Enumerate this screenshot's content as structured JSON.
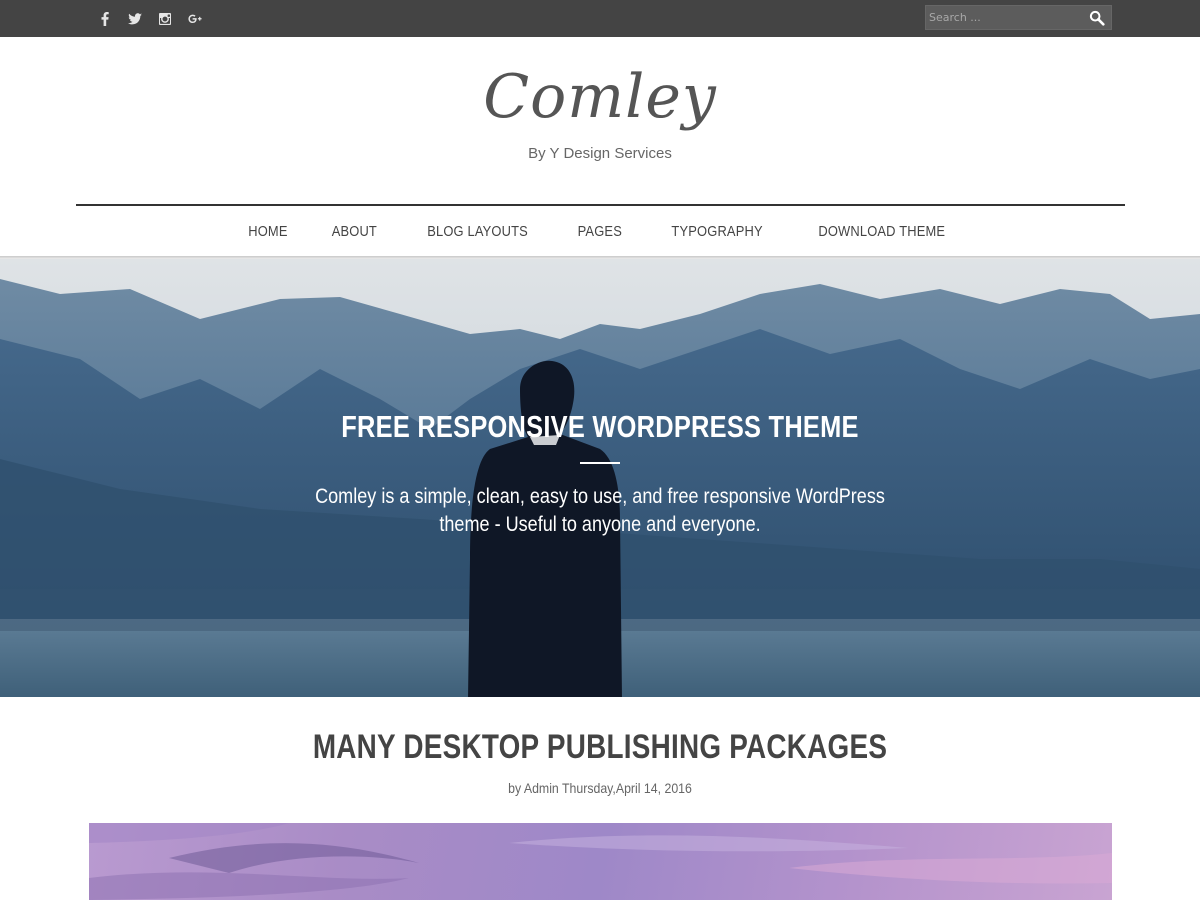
{
  "topbar": {
    "social": [
      {
        "name": "facebook-icon",
        "glyph": "f"
      },
      {
        "name": "twitter-icon",
        "glyph": ""
      },
      {
        "name": "instagram-icon",
        "glyph": ""
      },
      {
        "name": "google-plus-icon",
        "glyph": "g+"
      }
    ],
    "search": {
      "placeholder": "Search ...",
      "value": "",
      "icon": "search-icon"
    }
  },
  "header": {
    "logo": "Comley",
    "tagline": "By Y Design Services"
  },
  "nav": {
    "items": [
      "HOME",
      "ABOUT",
      "BLOG LAYOUTS",
      "PAGES",
      "TYPOGRAPHY",
      "DOWNLOAD THEME"
    ]
  },
  "hero": {
    "title": "FREE RESPONSIVE WORDPRESS THEME",
    "text": "Comley is a simple, clean, easy to use, and free responsive WordPress theme - Useful to anyone and everyone."
  },
  "post": {
    "title": "MANY DESKTOP PUBLISHING PACKAGES",
    "meta": "by Admin Thursday,April 14, 2016"
  },
  "colors": {
    "topbar": "#444444",
    "text": "#444444",
    "hero_overlay": "#3f6282"
  }
}
